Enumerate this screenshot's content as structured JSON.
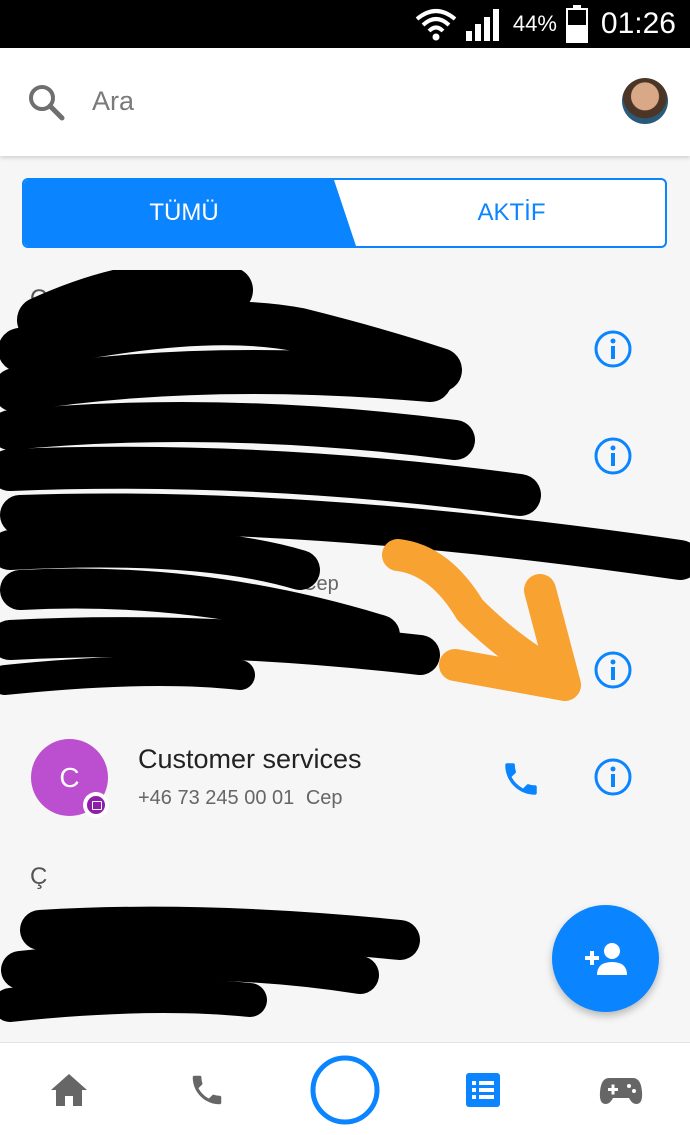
{
  "status_bar": {
    "battery_percent": "44%",
    "time": "01:26",
    "icons": [
      "wifi-icon",
      "signal-icon",
      "battery-icon"
    ]
  },
  "search": {
    "placeholder": "Ara",
    "icon": "search-icon"
  },
  "tabs": {
    "all_label": "TÜMÜ",
    "active_label": "AKTİF",
    "selected": "all"
  },
  "sections": [
    {
      "letter": "C"
    },
    {
      "letter": "Ç"
    }
  ],
  "redacted_rows": [
    {
      "sub_label": "Cep"
    }
  ],
  "contact": {
    "initial": "C",
    "name": "Customer services",
    "phone": "+46 73 245 00 01",
    "phone_type": "Cep"
  },
  "fab": {
    "icon": "add-person-icon"
  },
  "bottom_nav": [
    {
      "icon": "home-icon"
    },
    {
      "icon": "phone-icon"
    },
    {
      "icon": "camera-circle-icon"
    },
    {
      "icon": "contacts-list-icon",
      "selected": true
    },
    {
      "icon": "game-controller-icon"
    }
  ],
  "colors": {
    "accent": "#0a84ff",
    "avatar_purple": "#bb4fcf",
    "annotation_orange": "#f7a231",
    "redaction": "#000000"
  }
}
